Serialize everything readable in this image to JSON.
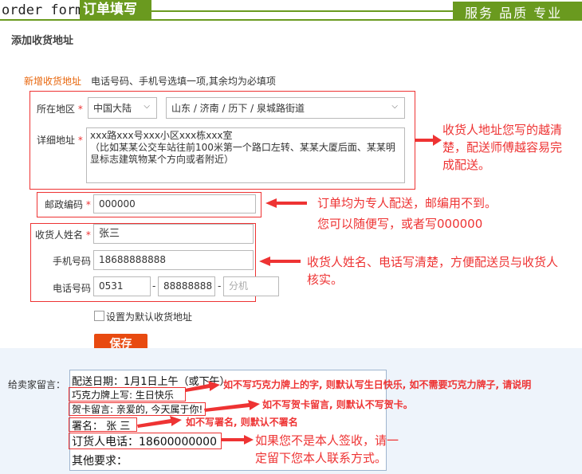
{
  "header": {
    "title": "order form",
    "tab_label": "订单填写",
    "slogan": "服务 品质 专业"
  },
  "section_title": "添加收货地址",
  "form": {
    "new_address_label": "新增收货地址",
    "tip": "电话号码、手机号选填一项,其余均为必填项",
    "region_label": "所在地区",
    "country_value": "中国大陆",
    "region_value": "山东 / 济南 / 历下 / 泉城路街道",
    "detail_label": "详细地址",
    "detail_line1": "xxx路xxx号xxx小区xxx栋xxx室",
    "detail_line2": "（比如某某公交车站往前100米第一个路口左转、某某大厦后面、某某明",
    "detail_line3": "显标志建筑物某个方向或者附近）",
    "postcode_label": "邮政编码",
    "postcode_value": "000000",
    "name_label": "收货人姓名",
    "name_value": "张三",
    "mobile_label": "手机号码",
    "mobile_value": "18688888888",
    "phone_label": "电话号码",
    "phone_area": "0531",
    "phone_number": "88888888",
    "phone_ext_placeholder": "分机",
    "phone_sep1": "-",
    "phone_sep2": "-",
    "required_mark": "*",
    "default_checkbox_label": "设置为默认收货地址",
    "save_label": "保存"
  },
  "annotations": {
    "address_note": [
      "收货人地址您写的越清",
      "楚，配送师傅越容易完",
      "成配送。"
    ],
    "postcode_note1": "订单均为专人配送，邮编用不到。",
    "postcode_note2": "您可以随便写，或者写000000",
    "name_note": [
      "收货人姓名、电话写清楚，方便配送员与收货人",
      "核实。"
    ],
    "chocolate_note": "如不写巧克力牌上的字, 则默认写生日快乐, 如不需要巧克力牌子, 请说明",
    "card_note": "如不写贺卡留言, 则默认不写贺卡。",
    "sign_note": "如不写署名, 则默认不署名",
    "contact_note": [
      "如果您不是本人签收，请一",
      "定留下您本人联系方式。"
    ]
  },
  "notes": {
    "label": "给卖家留言：",
    "line_delivery": "配送日期：1月1日上午（或下午）",
    "line_chocolate": "巧克力牌上写: 生日快乐",
    "line_card": "贺卡留言: 亲爱的, 今天属于你!",
    "line_sign": "署名：  张 三",
    "line_phone": "订货人电话：18600000000",
    "line_other": "其他要求："
  },
  "colors": {
    "brand_green": "#6a9a1f",
    "accent_red": "#e33333",
    "save_orange": "#e84a10",
    "label_orange": "#e8660c"
  }
}
